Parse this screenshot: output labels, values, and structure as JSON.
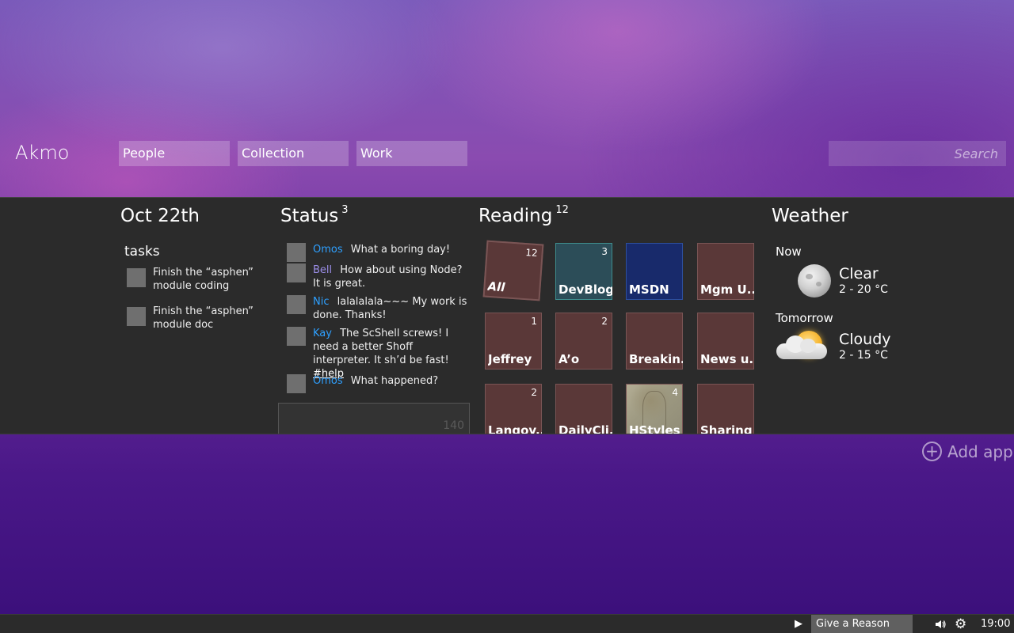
{
  "app": {
    "title": "Akmo"
  },
  "nav": {
    "tabs": [
      {
        "label": "People"
      },
      {
        "label": "Collection"
      },
      {
        "label": "Work"
      }
    ]
  },
  "search": {
    "placeholder": "Search"
  },
  "tasks_section": {
    "title": "Oct 22th",
    "subtitle": "tasks",
    "items": [
      {
        "text": "Finish the “asphen” module coding"
      },
      {
        "text": "Finish the “asphen” module doc"
      }
    ]
  },
  "status_section": {
    "title": "Status",
    "count": "3",
    "items": [
      {
        "name": "Omos",
        "text": "What a boring day!"
      },
      {
        "name": "Bell",
        "text": "How about using Node? It is great."
      },
      {
        "name": "Nic",
        "text": "lalalalala~~~ My work is done. Thanks!"
      },
      {
        "name": "Kay",
        "text": "The ScShell screws! I need a better Shoff interpreter. It sh’d be fast!",
        "hashtag": "#help"
      },
      {
        "name": "Omos",
        "text": "What happened?"
      }
    ],
    "compose_counter": "140"
  },
  "reading_section": {
    "title": "Reading",
    "count": "12",
    "tiles": [
      {
        "label": "All",
        "count": "12"
      },
      {
        "label": "DevBlog",
        "count": "3"
      },
      {
        "label": "MSDN",
        "count": ""
      },
      {
        "label": "Mgm U...",
        "count": ""
      },
      {
        "label": "Jeffrey",
        "count": "1"
      },
      {
        "label": "A’o",
        "count": "2"
      },
      {
        "label": "Breakin...",
        "count": ""
      },
      {
        "label": "News u...",
        "count": ""
      },
      {
        "label": "Langov...",
        "count": "2"
      },
      {
        "label": "DailyCli...",
        "count": ""
      },
      {
        "label": "HStyles",
        "count": "4"
      },
      {
        "label": "Sharing",
        "count": ""
      }
    ]
  },
  "weather_section": {
    "title": "Weather",
    "now": {
      "label": "Now",
      "condition": "Clear",
      "temp": "2 - 20 °C",
      "icon": "moon-icon"
    },
    "tomorrow": {
      "label": "Tomorrow",
      "condition": "Cloudy",
      "temp": "2 - 15 °C",
      "icon": "partly-cloudy-icon"
    }
  },
  "add_app": {
    "label": "Add app"
  },
  "taskbar": {
    "now_playing": "Give a Reason",
    "clock": "19:00"
  },
  "colors": {
    "panel_bg": "#2b2b2b",
    "status_name_blue": "#2ea0ff",
    "status_name_purple": "#9b8ee8",
    "tile_bg": "#5a3838",
    "tile_teal": "#2c4d58",
    "tile_navy": "#182a6b"
  }
}
